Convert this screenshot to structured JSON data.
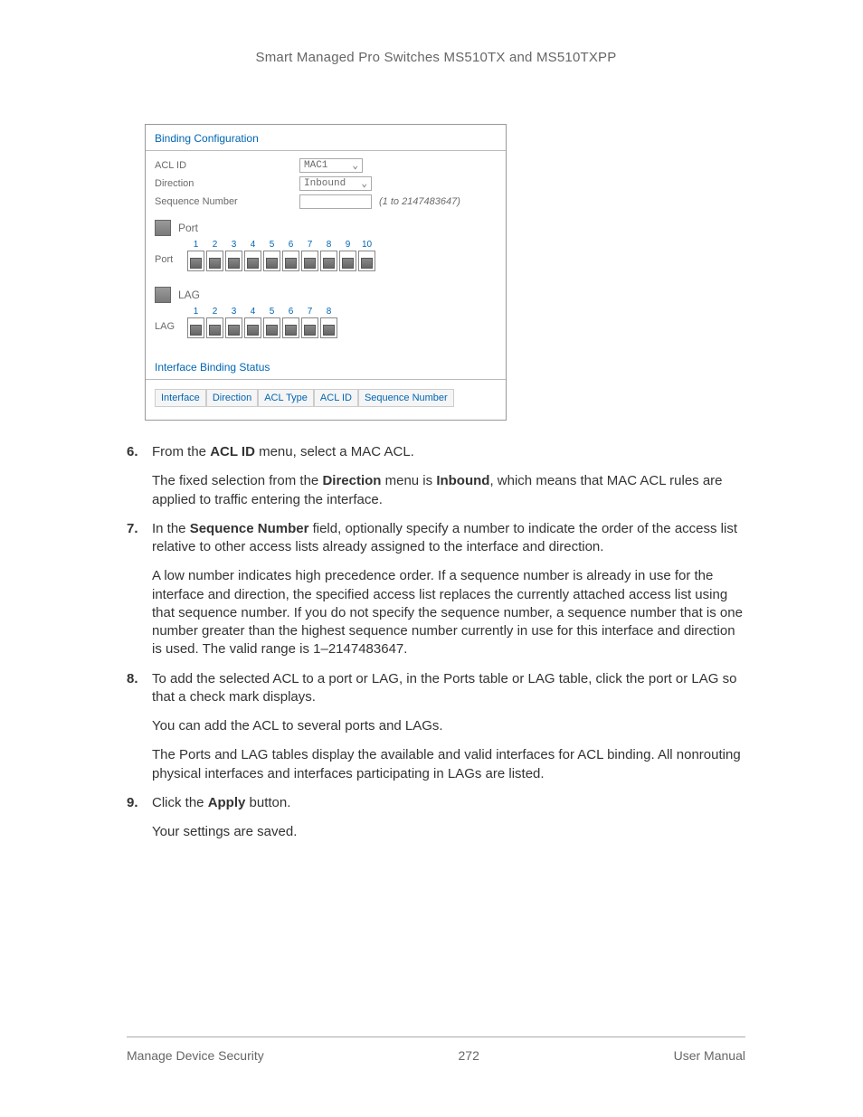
{
  "header": {
    "title": "Smart Managed Pro Switches MS510TX and MS510TXPP"
  },
  "figure": {
    "title": "Binding Configuration",
    "fields": {
      "acl_id_label": "ACL ID",
      "acl_id_value": "MAC1",
      "direction_label": "Direction",
      "direction_value": "Inbound",
      "seq_label": "Sequence Number",
      "seq_range": "(1 to 2147483647)"
    },
    "port_group": "Port",
    "port_row_label": "Port",
    "ports": [
      "1",
      "2",
      "3",
      "4",
      "5",
      "6",
      "7",
      "8",
      "9",
      "10"
    ],
    "lag_group": "LAG",
    "lag_row_label": "LAG",
    "lags": [
      "1",
      "2",
      "3",
      "4",
      "5",
      "6",
      "7",
      "8"
    ],
    "status_title": "Interface Binding Status",
    "status_cols": [
      "Interface",
      "Direction",
      "ACL Type",
      "ACL ID",
      "Sequence Number"
    ]
  },
  "steps": {
    "s6": {
      "num": "6.",
      "p1a": "From the ",
      "p1b": "ACL ID",
      "p1c": " menu, select a MAC ACL.",
      "p2a": "The fixed selection from the ",
      "p2b": "Direction",
      "p2c": " menu is ",
      "p2d": "Inbound",
      "p2e": ", which means that MAC ACL rules are applied to traffic entering the interface."
    },
    "s7": {
      "num": "7.",
      "p1a": "In the ",
      "p1b": "Sequence Number",
      "p1c": " field, optionally specify a number to indicate the order of the access list relative to other access lists already assigned to the interface and direction.",
      "p2": "A low number indicates high precedence order. If a sequence number is already in use for the interface and direction, the specified access list replaces the currently attached access list using that sequence number. If you do not specify the sequence number, a sequence number that is one number greater than the highest sequence number currently in use for this interface and direction is used. The valid range is 1–2147483647."
    },
    "s8": {
      "num": "8.",
      "p1": "To add the selected ACL to a port or LAG, in the Ports table or LAG table, click the port or LAG so that a check mark displays.",
      "p2": "You can add the ACL to several ports and LAGs.",
      "p3": "The Ports and LAG tables display the available and valid interfaces for ACL binding. All nonrouting physical interfaces and interfaces participating in LAGs are listed."
    },
    "s9": {
      "num": "9.",
      "p1a": "Click the ",
      "p1b": "Apply",
      "p1c": " button.",
      "p2": "Your settings are saved."
    }
  },
  "footer": {
    "left": "Manage Device Security",
    "center": "272",
    "right": "User Manual"
  }
}
